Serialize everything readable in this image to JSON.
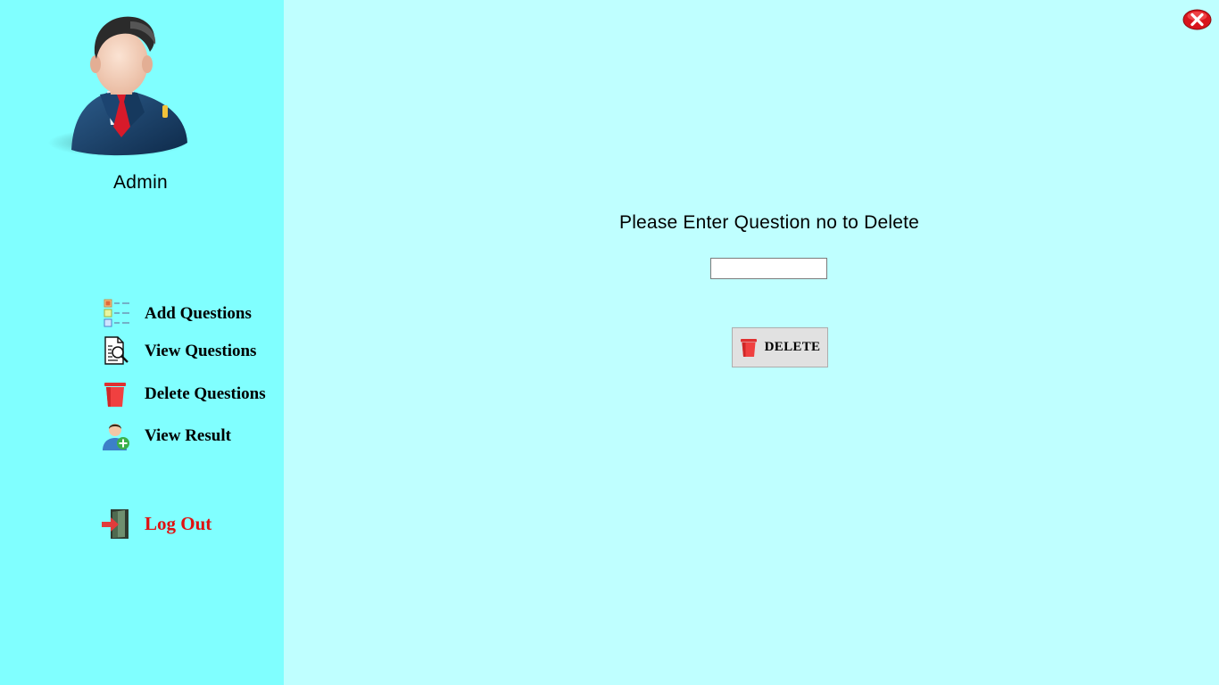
{
  "sidebar": {
    "user_name": "Admin",
    "nav": {
      "add_questions": "Add Questions",
      "view_questions": "View Questions",
      "delete_questions": "Delete Questions",
      "view_result": "View Result",
      "log_out": "Log Out"
    }
  },
  "main": {
    "prompt": "Please Enter Question no to Delete",
    "question_no_value": "",
    "delete_button_label": "DELETE"
  },
  "icons": {
    "avatar": "admin-avatar",
    "add_questions": "list-add-icon",
    "view_questions": "document-search-icon",
    "delete_questions": "trash-icon",
    "view_result": "user-add-icon",
    "log_out": "exit-door-icon",
    "close": "close-icon"
  },
  "colors": {
    "sidebar_bg": "#80ffff",
    "main_bg": "#bfffff",
    "logout_text": "#e01010",
    "button_bg": "#e1e1e1"
  }
}
